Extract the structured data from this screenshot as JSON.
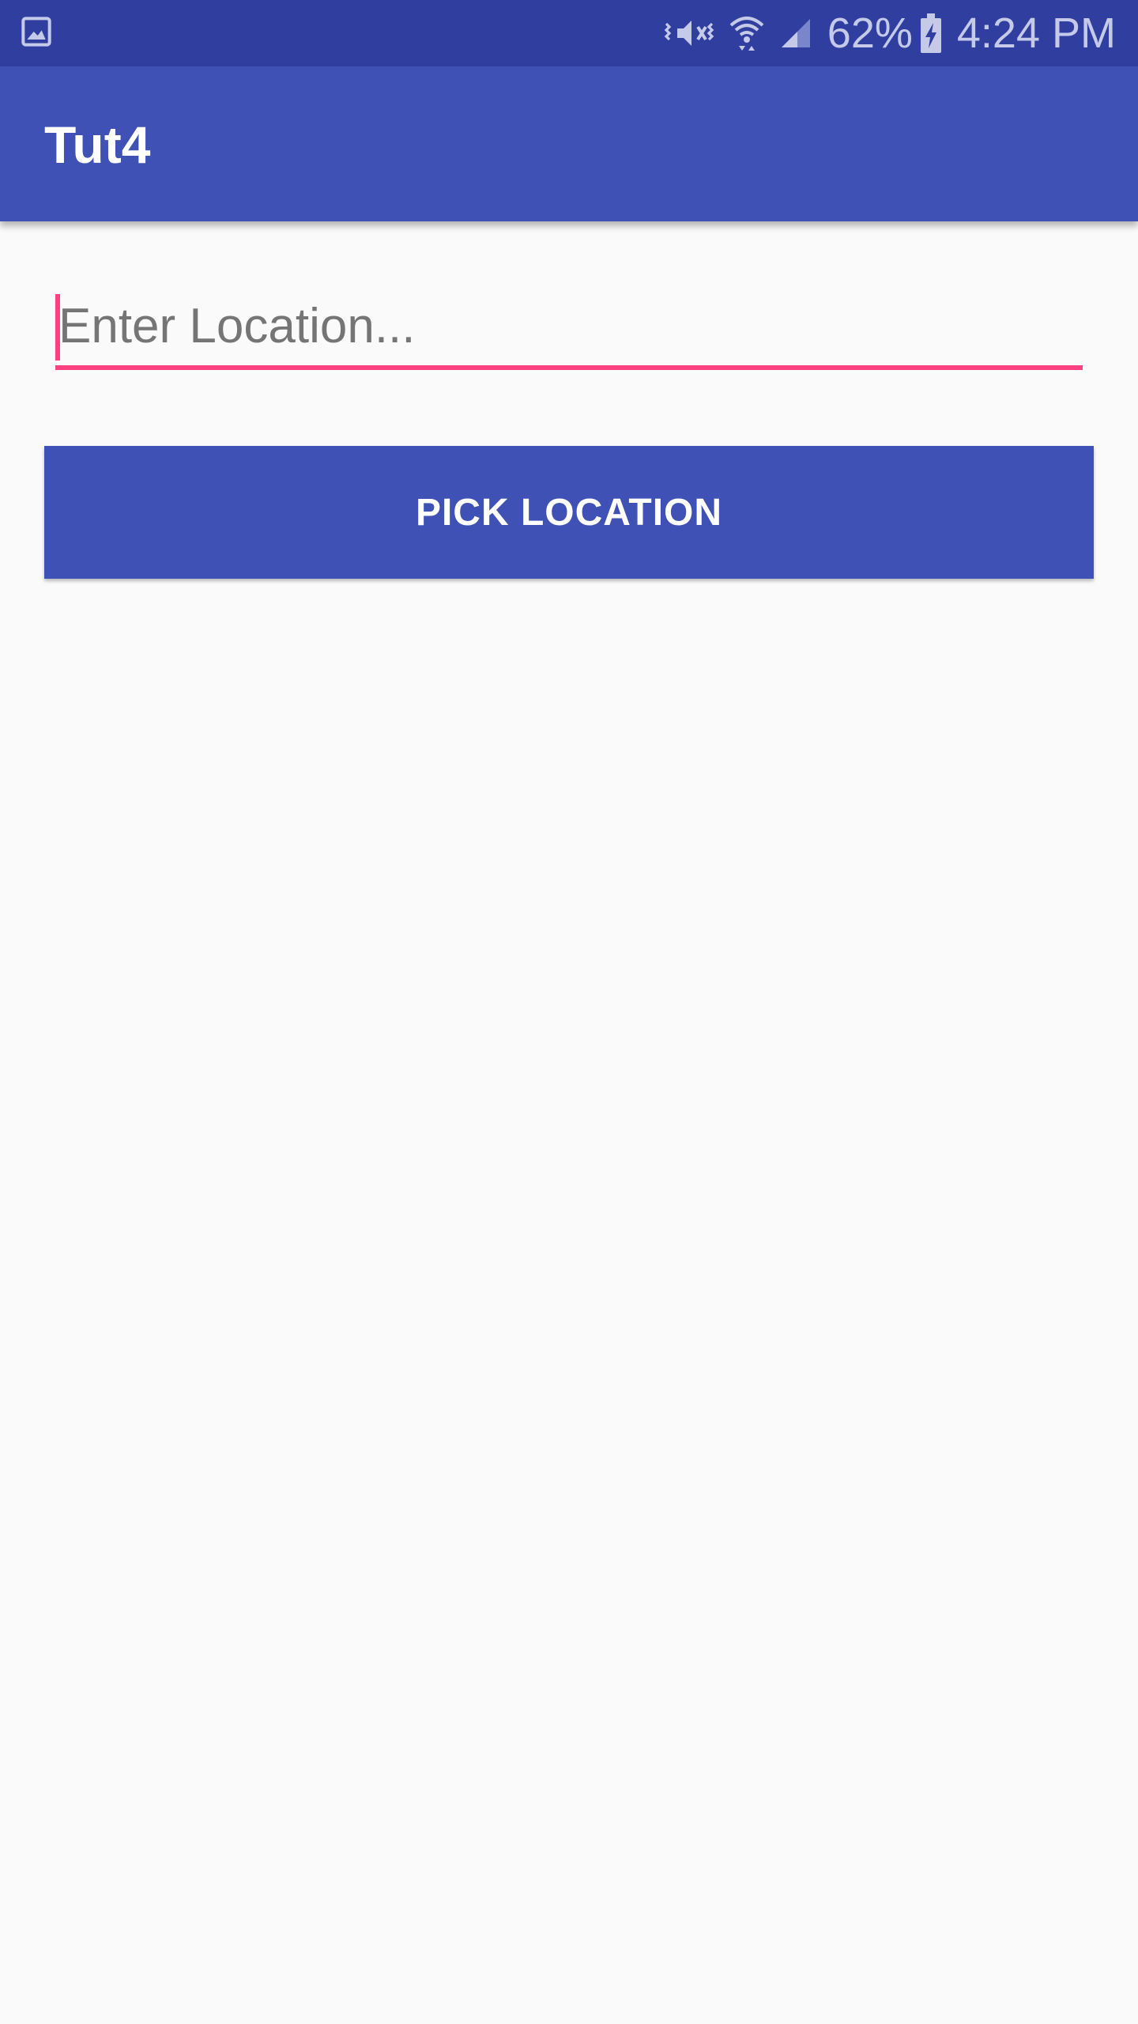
{
  "status_bar": {
    "left_icon": "image-icon",
    "icons": [
      "vibrate-mute-icon",
      "wifi-icon",
      "cell-signal-icon"
    ],
    "battery_percent": "62%",
    "battery_icon": "battery-charging-icon",
    "time": "4:24 PM"
  },
  "app_bar": {
    "title": "Tut4"
  },
  "main": {
    "location_input": {
      "placeholder": "Enter Location...",
      "value": ""
    },
    "pick_button_label": "PICK LOCATION"
  },
  "colors": {
    "primary": "#3f51b5",
    "primary_dark": "#303f9f",
    "accent": "#ff4081",
    "background": "#fafafa"
  }
}
